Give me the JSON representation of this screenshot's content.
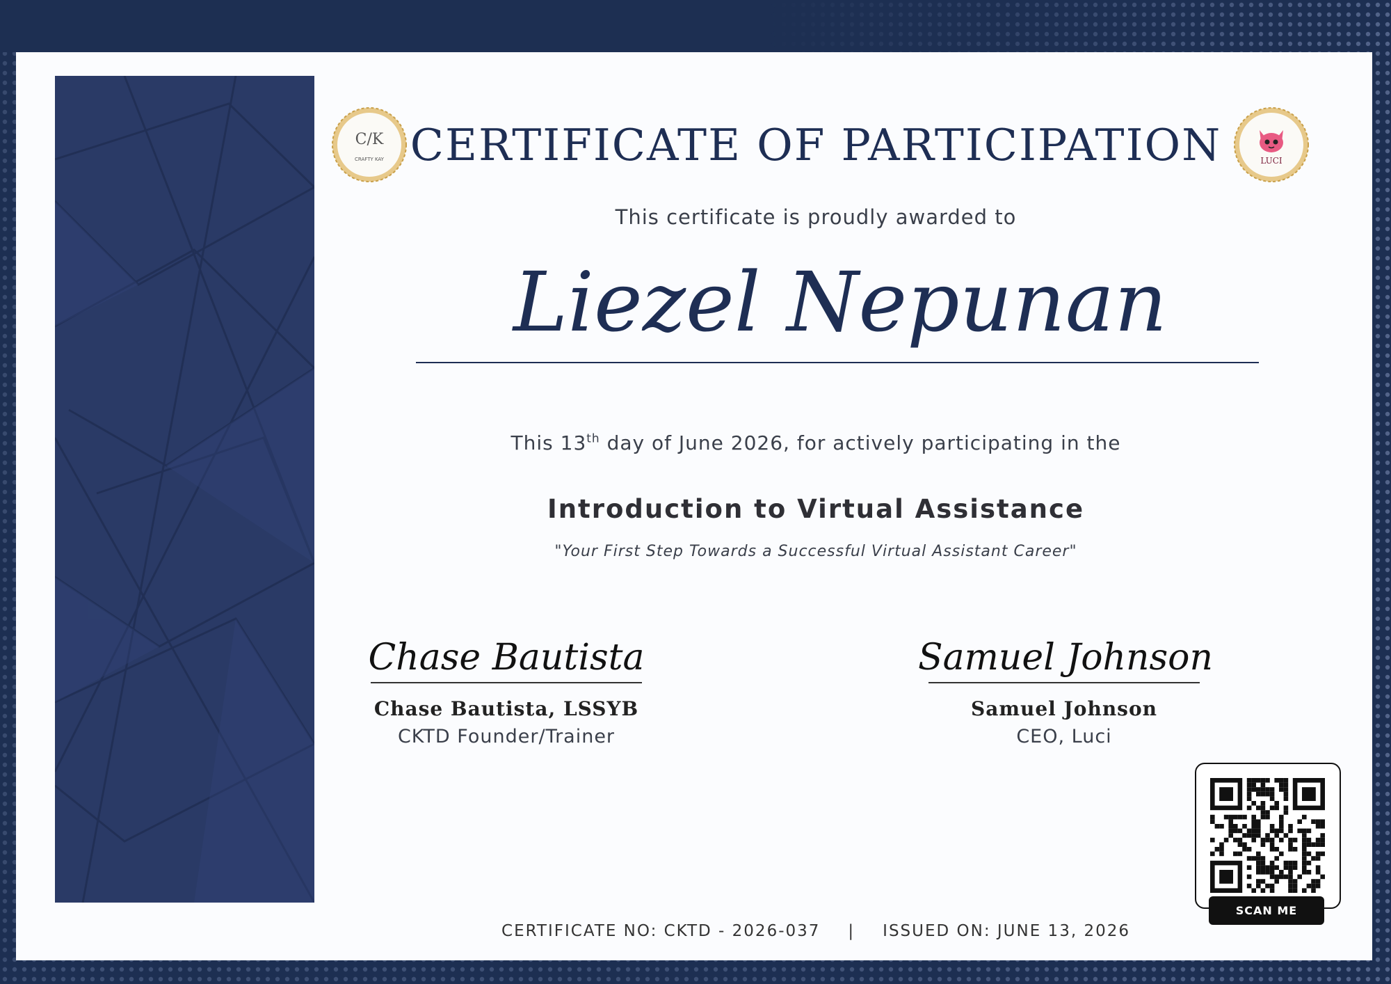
{
  "certificate": {
    "title": "CERTIFICATE OF PARTICIPATION",
    "subtitle": "This certificate is proudly awarded to",
    "recipient_name": "Liezel Nepunan",
    "date_prefix": "This 13",
    "date_suffix": "th",
    "date_rest": " day of June 2026, for actively participating in the",
    "course_title": "Introduction to Virtual Assistance",
    "tagline": "\"Your First Step Towards a Successful Virtual Assistant Career\""
  },
  "seals": {
    "left_monogram": "C/K",
    "left_text": "CRAFTY KAY",
    "right_text": "LUCI"
  },
  "signatories": [
    {
      "signature": "Chase Bautista",
      "name": "Chase Bautista, LSSYB",
      "role": "CKTD Founder/Trainer"
    },
    {
      "signature": "Samuel Johnson",
      "name": "Samuel Johnson",
      "role": "CEO, Luci"
    }
  ],
  "qr": {
    "label": "SCAN ME"
  },
  "footer": {
    "certificate_no": "CERTIFICATE NO: CKTD - 2026-037",
    "separator": "|",
    "issued_on": "ISSUED ON: JUNE 13, 2026"
  },
  "colors": {
    "navy": "#1e2e54",
    "background": "#1d2f52",
    "paper": "#fbfcfe",
    "gold": "#c9a04a"
  }
}
